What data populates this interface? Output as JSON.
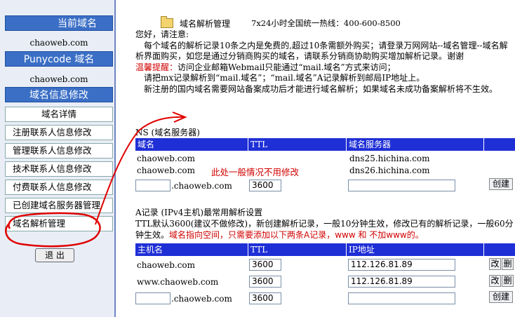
{
  "sidebar": {
    "current_domain_header": "当前域名",
    "current_domain_value": "chaoweb.com",
    "punycode_header": "Punycode 域名",
    "punycode_value": "chaoweb.com",
    "modify_header": "域名信息修改",
    "items": [
      "域名详情",
      "注册联系人信息修改",
      "管理联系人信息修改",
      "技术联系人信息修改",
      "付费联系人信息修改",
      "已创建域名服务器管理",
      "域名解析管理"
    ],
    "logout_label": "退 出"
  },
  "header": {
    "title": "域名解析管理",
    "hotline": "7x24小时全国统一热线：400-600-8500"
  },
  "notice": {
    "greeting": "您好，请注意:",
    "line1": "每个域名的解析记录10条之内是免费的,超过10条需额外购买；请登录万网网站--域名管理--域名解析界面购买，如您是通过分销商购买的域名，请联系分销商协助购买增加解析记录。谢谢",
    "tip_label": "温馨提醒：",
    "tip_text": "访问企业邮箱Webmail只能通过“mail.域名”方式来访问；",
    "line3": "请把mx记录解析到“mail.域名”；“mail.域名”A记录解析到邮局IP地址上。",
    "line4": "新注册的国内域名需要网站备案成功后才能进行域名解析；如果域名未成功备案解析将不生效。"
  },
  "ns": {
    "title": "NS (域名服务器)",
    "columns": [
      "域名",
      "TTL",
      "域名服务器"
    ],
    "rows": [
      {
        "domain": "chaoweb.com",
        "server": "dns25.hichina.com"
      },
      {
        "domain": "chaoweb.com",
        "server": "dns26.hichina.com"
      }
    ],
    "annotation": "此处一般情况不用修改",
    "new_suffix": ".chaoweb.com",
    "new_ttl": "3600",
    "create_label": "创建"
  },
  "a_record": {
    "title": "A记录 (IPv4主机)最常用解析设置",
    "desc_part1": "TTL默认3600(建议不做修改)，新创建解析记录，一般10分钟生效，修改已有的解析记录，一般60分钟生效。",
    "desc_red": "域名指向空间，只需要添加以下两条A记录，www 和 不加www的。",
    "columns": [
      "主机名",
      "TTL",
      "IP地址"
    ],
    "rows": [
      {
        "host": "chaoweb.com",
        "ttl": "3600",
        "ip": "112.126.81.89"
      },
      {
        "host": "www.chaoweb.com",
        "ttl": "3600",
        "ip": "112.126.81.89"
      }
    ],
    "modify_label": "改",
    "delete_label": "删",
    "new_suffix": ".chaoweb.com",
    "new_ttl": "3600",
    "create_label": "创建"
  },
  "colors": {
    "header_blue": "#3b6fc6",
    "table_head": "#1f2fd6",
    "annotation_red": "#d10000"
  }
}
